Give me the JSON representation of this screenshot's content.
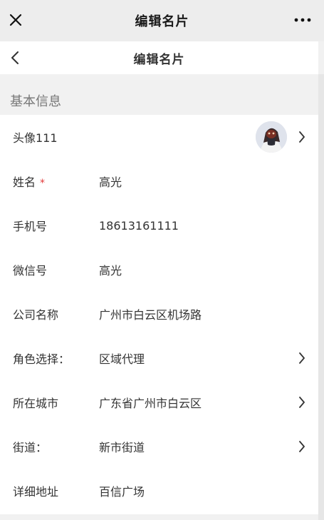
{
  "window": {
    "title": "编辑名片"
  },
  "header": {
    "title": "编辑名片"
  },
  "section": {
    "title": "基本信息"
  },
  "fields": {
    "avatar": {
      "label": "头像111"
    },
    "name": {
      "label": "姓名",
      "required_mark": "*",
      "value": "高光"
    },
    "phone": {
      "label": "手机号",
      "value": "18613161111"
    },
    "wechat": {
      "label": "微信号",
      "value": "高光"
    },
    "company": {
      "label": "公司名称",
      "value": "广州市白云区机场路"
    },
    "role": {
      "label": "角色选择：",
      "value": "区域代理"
    },
    "city": {
      "label": "所在城市",
      "value": "广东省广州市白云区"
    },
    "street": {
      "label": "街道：",
      "value": "新市街道"
    },
    "address": {
      "label": "详细地址",
      "value": "百信广场"
    }
  },
  "icons": {
    "close": "close-icon",
    "more": "more-icon",
    "back": "chevron-left-icon",
    "chevron": "chevron-right-icon"
  },
  "colors": {
    "required": "#e23a3a",
    "topbar": "#ededed",
    "background": "#f1f1f1"
  }
}
